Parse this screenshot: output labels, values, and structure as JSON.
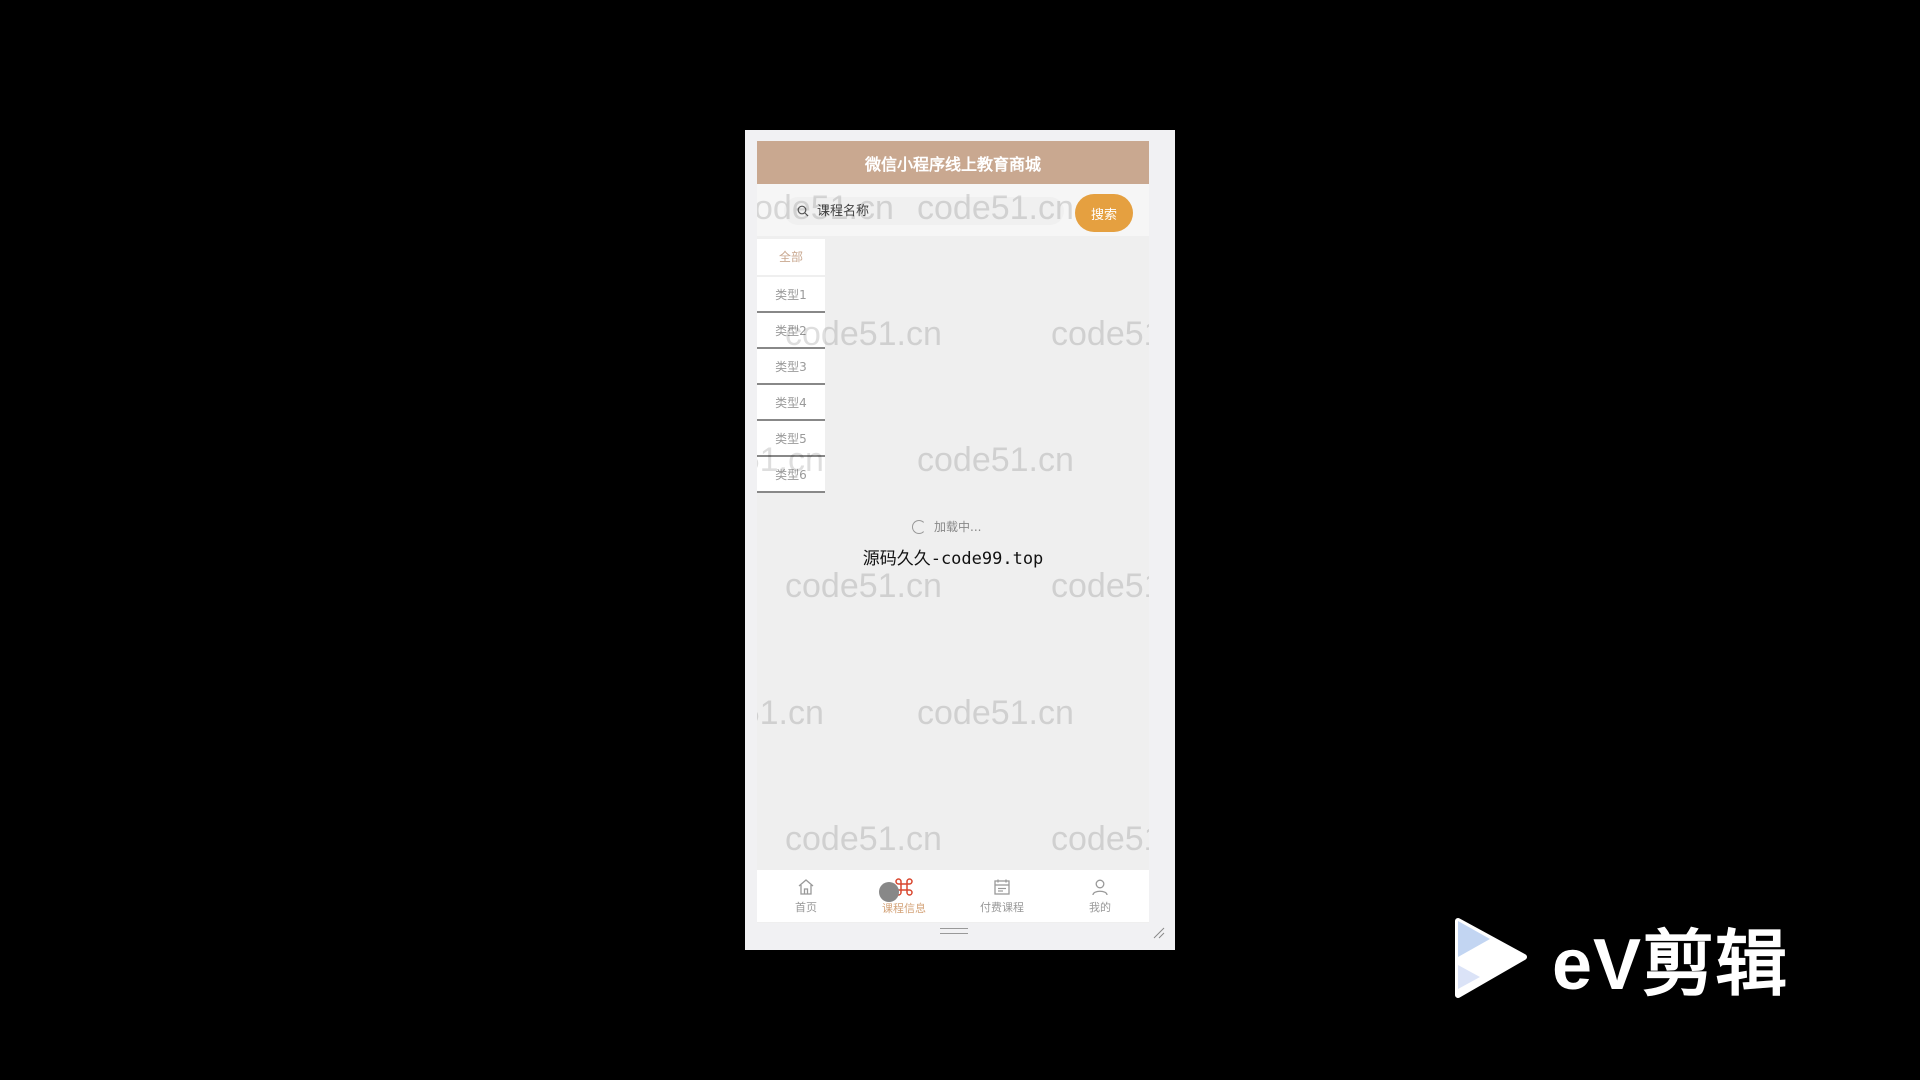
{
  "app": {
    "title": "微信小程序线上教育商城"
  },
  "search": {
    "placeholder": "课程名称",
    "button_label": "搜索"
  },
  "categories": [
    {
      "label": "全部"
    },
    {
      "label": "类型1"
    },
    {
      "label": "类型2"
    },
    {
      "label": "类型3"
    },
    {
      "label": "类型4"
    },
    {
      "label": "类型5"
    },
    {
      "label": "类型6"
    }
  ],
  "status": {
    "loading_text": "加载中...",
    "source_text": "源码久久-code99.top"
  },
  "watermark": {
    "text": "code51.cn"
  },
  "tabbar": {
    "items": [
      {
        "label": "首页",
        "icon": "home-icon"
      },
      {
        "label": "课程信息",
        "icon": "command-icon"
      },
      {
        "label": "付费课程",
        "icon": "calendar-icon"
      },
      {
        "label": "我的",
        "icon": "user-icon"
      }
    ]
  },
  "branding": {
    "ev_text": "eV剪辑"
  },
  "colors": {
    "header": "#c9a890",
    "search_button": "#e5a040",
    "active_category": "#c9a890",
    "active_tab": "#d4a47a"
  }
}
